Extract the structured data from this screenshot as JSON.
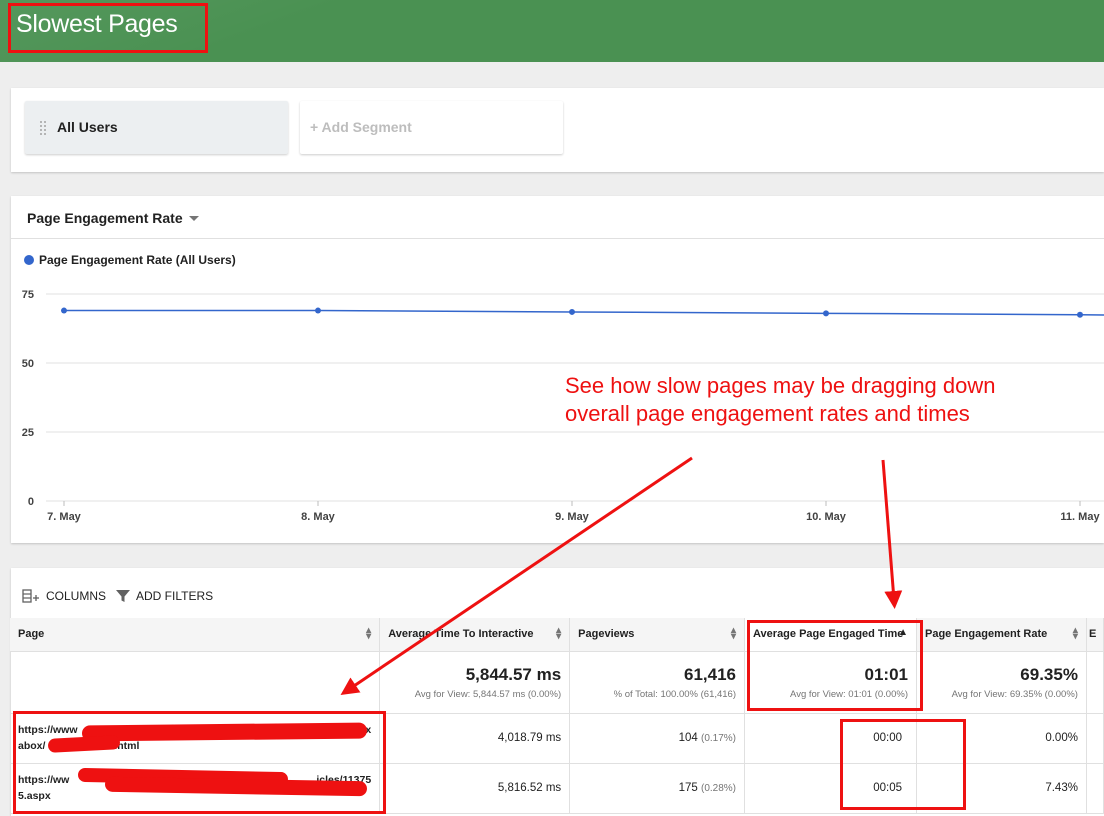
{
  "header": {
    "title": "Slowest Pages"
  },
  "segments": {
    "all_users": "All Users",
    "add_segment": "+ Add Segment"
  },
  "chart_panel": {
    "metric_selector": "Page Engagement Rate"
  },
  "annotation": {
    "line1": "See how slow pages may be dragging down",
    "line2": "overall page engagement rates and times"
  },
  "colors": {
    "header": "#4a9152",
    "series": "#3366cc",
    "annotation": "#ee1111"
  },
  "chart_data": {
    "type": "line",
    "x": [
      "7. May",
      "8. May",
      "9. May",
      "10. May",
      "11. May"
    ],
    "series": [
      {
        "name": "Page Engagement Rate (All Users)",
        "values": [
          69.0,
          69.0,
          68.5,
          68.0,
          67.5
        ]
      }
    ],
    "yticks": [
      "75",
      "50",
      "25",
      "0"
    ],
    "ylim": [
      0,
      75
    ],
    "grid": true,
    "legend": "top-left"
  },
  "toolbar": {
    "columns": "COLUMNS",
    "add_filters": "ADD FILTERS"
  },
  "table": {
    "headers": [
      "Page",
      "Average Time To Interactive",
      "Pageviews",
      "Average Page Engaged Time",
      "Page Engagement Rate",
      "E"
    ],
    "totals": {
      "time_to_interactive": "5,844.57 ms",
      "time_to_interactive_sub": "Avg for View: 5,844.57 ms (0.00%)",
      "pageviews": "61,416",
      "pageviews_sub": "% of Total: 100.00% (61,416)",
      "engaged_time": "01:01",
      "engaged_time_sub": "Avg for View: 01:01 (0.00%)",
      "engagement_rate": "69.35%",
      "engagement_rate_sub": "Avg for View: 69.35% (0.00%)"
    },
    "rows": [
      {
        "page_line1": "https://www",
        "page_line1_end": "x",
        "page_line2": "abox/",
        "page_line2_end": "ter.html",
        "tti": "4,018.79 ms",
        "pageviews": "104",
        "pageviews_pct": "(0.17%)",
        "engaged_time": "00:00",
        "rate": "0.00%"
      },
      {
        "page_line1": "https://ww",
        "page_line1_end": "icles/11375",
        "page_line2": "5.aspx",
        "page_line2_end": "",
        "tti": "5,816.52 ms",
        "pageviews": "175",
        "pageviews_pct": "(0.28%)",
        "engaged_time": "00:05",
        "rate": "7.43%"
      }
    ]
  }
}
